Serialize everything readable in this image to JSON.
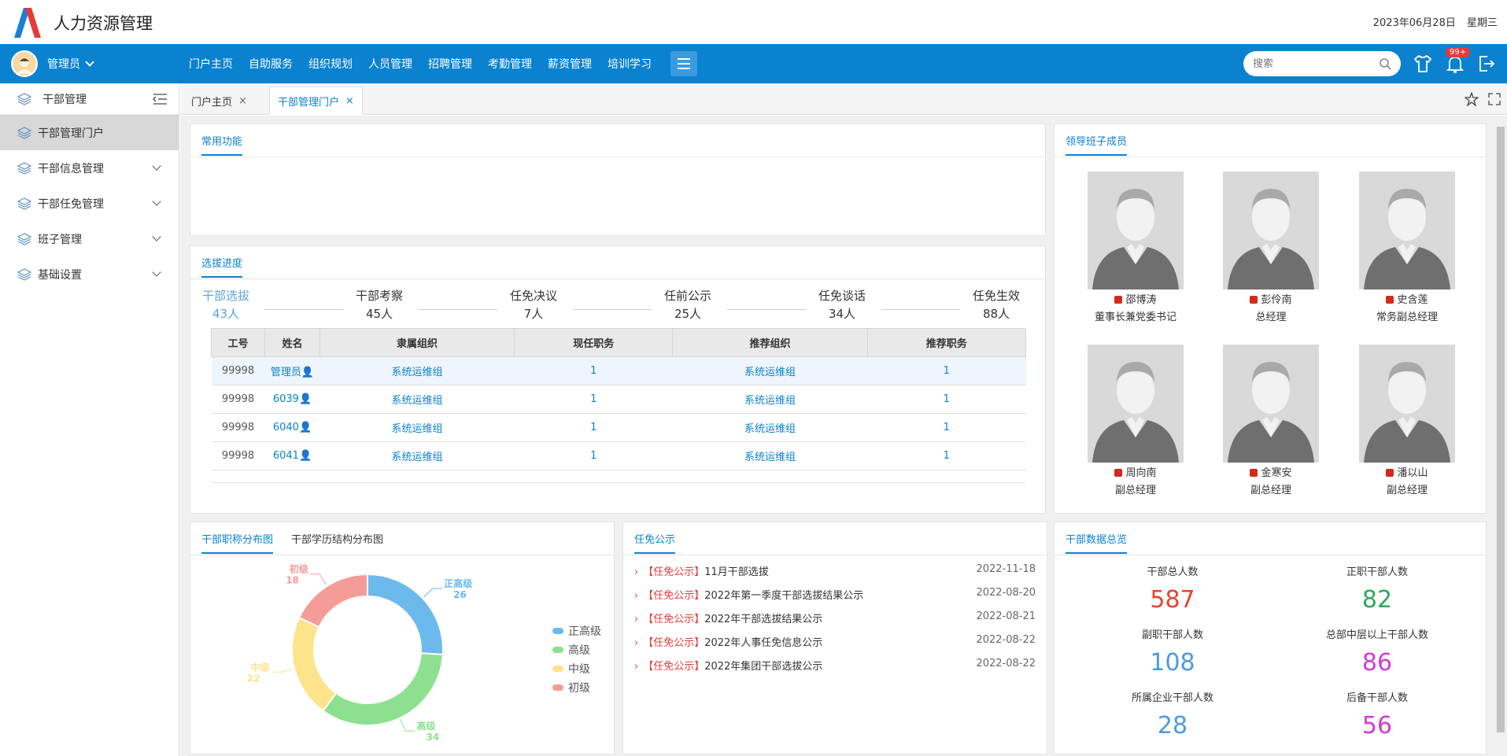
{
  "app": {
    "title": "人力资源管理",
    "date": "2023年06月28日",
    "weekday": "星期三"
  },
  "nav": {
    "user": "管理员",
    "menu": [
      "门户主页",
      "自助服务",
      "组织规划",
      "人员管理",
      "招聘管理",
      "考勤管理",
      "薪资管理",
      "培训学习"
    ],
    "search_placeholder": "搜索",
    "badge": "99+"
  },
  "sidebar": {
    "head": "干部管理",
    "items": [
      {
        "label": "干部管理门户",
        "active": true
      },
      {
        "label": "干部信息管理"
      },
      {
        "label": "干部任免管理"
      },
      {
        "label": "班子管理"
      },
      {
        "label": "基础设置"
      }
    ]
  },
  "tabs": [
    {
      "label": "门户主页"
    },
    {
      "label": "干部管理门户",
      "active": true
    }
  ],
  "panels": {
    "common": {
      "title": "常用功能"
    },
    "progress": {
      "title": "选拔进度",
      "steps": [
        {
          "name": "干部选拔",
          "count": "43人"
        },
        {
          "name": "干部考察",
          "count": "45人"
        },
        {
          "name": "任免决议",
          "count": "7人"
        },
        {
          "name": "任前公示",
          "count": "25人"
        },
        {
          "name": "任免谈话",
          "count": "34人"
        },
        {
          "name": "任免生效",
          "count": "88人"
        }
      ],
      "columns": [
        "工号",
        "姓名",
        "隶属组织",
        "现任职务",
        "推荐组织",
        "推荐职务"
      ],
      "rows": [
        [
          "99998",
          "管理员",
          "系统运维组",
          "1",
          "系统运维组",
          "1"
        ],
        [
          "99998",
          "6039",
          "系统运维组",
          "1",
          "系统运维组",
          "1"
        ],
        [
          "99998",
          "6040",
          "系统运维组",
          "1",
          "系统运维组",
          "1"
        ],
        [
          "99998",
          "6041",
          "系统运维组",
          "1",
          "系统运维组",
          "1"
        ]
      ]
    },
    "leaders": {
      "title": "领导班子成员",
      "members": [
        {
          "name": "邵博涛",
          "title": "董事长兼党委书记"
        },
        {
          "name": "彭伶南",
          "title": "总经理"
        },
        {
          "name": "史含莲",
          "title": "常务副总经理"
        },
        {
          "name": "周向南",
          "title": "副总经理"
        },
        {
          "name": "金寒安",
          "title": "副总经理"
        },
        {
          "name": "潘以山",
          "title": "副总经理"
        }
      ]
    },
    "distribution": {
      "tab1": "干部职称分布图",
      "tab2": "干部学历结构分布图"
    },
    "notices": {
      "title": "任免公示",
      "items": [
        {
          "tag": "【任免公示】",
          "text": "11月干部选拔",
          "date": "2022-11-18"
        },
        {
          "tag": "【任免公示】",
          "text": "2022年第一季度干部选拔结果公示",
          "date": "2022-08-20"
        },
        {
          "tag": "【任免公示】",
          "text": "2022年干部选拔结果公示",
          "date": "2022-08-21"
        },
        {
          "tag": "【任免公示】",
          "text": "2022年人事任免信息公示",
          "date": "2022-08-22"
        },
        {
          "tag": "【任免公示】",
          "text": "2022年集团干部选拔公示",
          "date": "2022-08-22"
        }
      ]
    },
    "overview": {
      "title": "干部数据总览",
      "stats": [
        {
          "label": "干部总人数",
          "value": "587",
          "color": "#e8432e"
        },
        {
          "label": "正职干部人数",
          "value": "82",
          "color": "#2aaa5a"
        },
        {
          "label": "副职干部人数",
          "value": "108",
          "color": "#4a9be0"
        },
        {
          "label": "总部中层以上干部人数",
          "value": "86",
          "color": "#d43ad4"
        },
        {
          "label": "所属企业干部人数",
          "value": "28",
          "color": "#4a9be0"
        },
        {
          "label": "后备干部人数",
          "value": "56",
          "color": "#d43ad4"
        }
      ]
    }
  },
  "chart_data": {
    "type": "pie",
    "categories": [
      "正高级",
      "高级",
      "中级",
      "初级"
    ],
    "values": [
      26,
      34,
      22,
      18
    ],
    "colors": [
      "#6cb9ec",
      "#8de08f",
      "#fde38a",
      "#f59c98"
    ],
    "legend_position": "right"
  }
}
